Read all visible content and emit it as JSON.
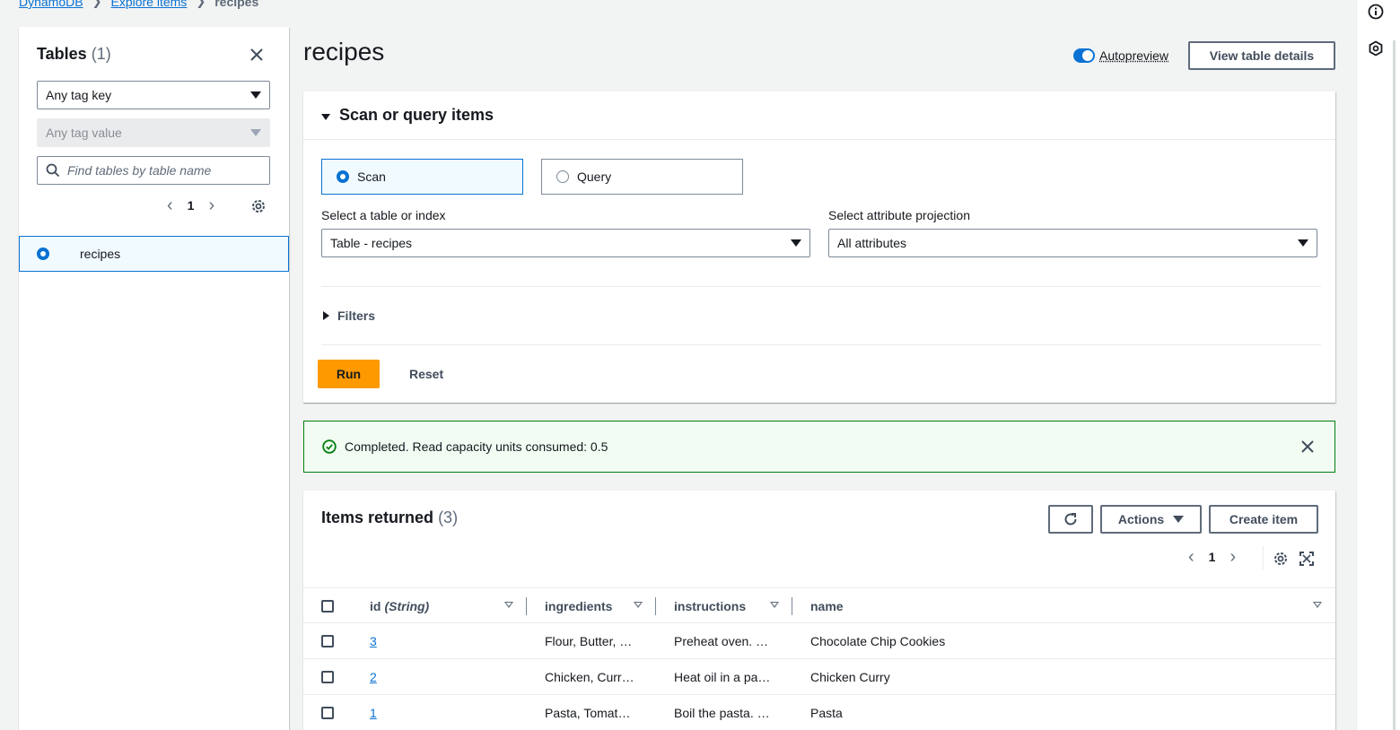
{
  "breadcrumb": {
    "items": [
      "DynamoDB",
      "Explore items"
    ],
    "current": "recipes"
  },
  "tables_panel": {
    "title": "Tables",
    "count": "(1)",
    "tag_key": "Any tag key",
    "tag_value": "Any tag value",
    "search_placeholder": "Find tables by table name",
    "page": "1",
    "tables": [
      {
        "name": "recipes",
        "selected": true
      }
    ]
  },
  "header": {
    "title": "recipes",
    "autopreview_label": "Autopreview",
    "autopreview_on": true,
    "view_details_label": "View table details"
  },
  "scan_panel": {
    "title": "Scan or query items",
    "mode_scan": "Scan",
    "mode_query": "Query",
    "selected_mode": "Scan",
    "table_label": "Select a table or index",
    "table_value": "Table - recipes",
    "projection_label": "Select attribute projection",
    "projection_value": "All attributes",
    "filters_label": "Filters",
    "run_label": "Run",
    "reset_label": "Reset"
  },
  "alert": {
    "message": "Completed. Read capacity units consumed: 0.5",
    "status_color": "#037f0c"
  },
  "items": {
    "title": "Items returned",
    "count": "(3)",
    "actions_label": "Actions",
    "create_label": "Create item",
    "page": "1",
    "columns": {
      "id": "id",
      "id_type": "(String)",
      "ingredients": "ingredients",
      "instructions": "instructions",
      "name": "name"
    },
    "rows": [
      {
        "id": "3",
        "ingredients": "Flour, Butter, …",
        "instructions": "Preheat oven. …",
        "name": "Chocolate Chip Cookies"
      },
      {
        "id": "2",
        "ingredients": "Chicken, Curr…",
        "instructions": "Heat oil in a pa…",
        "name": "Chicken Curry"
      },
      {
        "id": "1",
        "ingredients": "Pasta, Tomat…",
        "instructions": "Boil the pasta. …",
        "name": "Pasta"
      }
    ]
  },
  "colors": {
    "accent": "#0972d3",
    "primary_button": "#ff9900",
    "success_bg": "#f2fcf3"
  }
}
